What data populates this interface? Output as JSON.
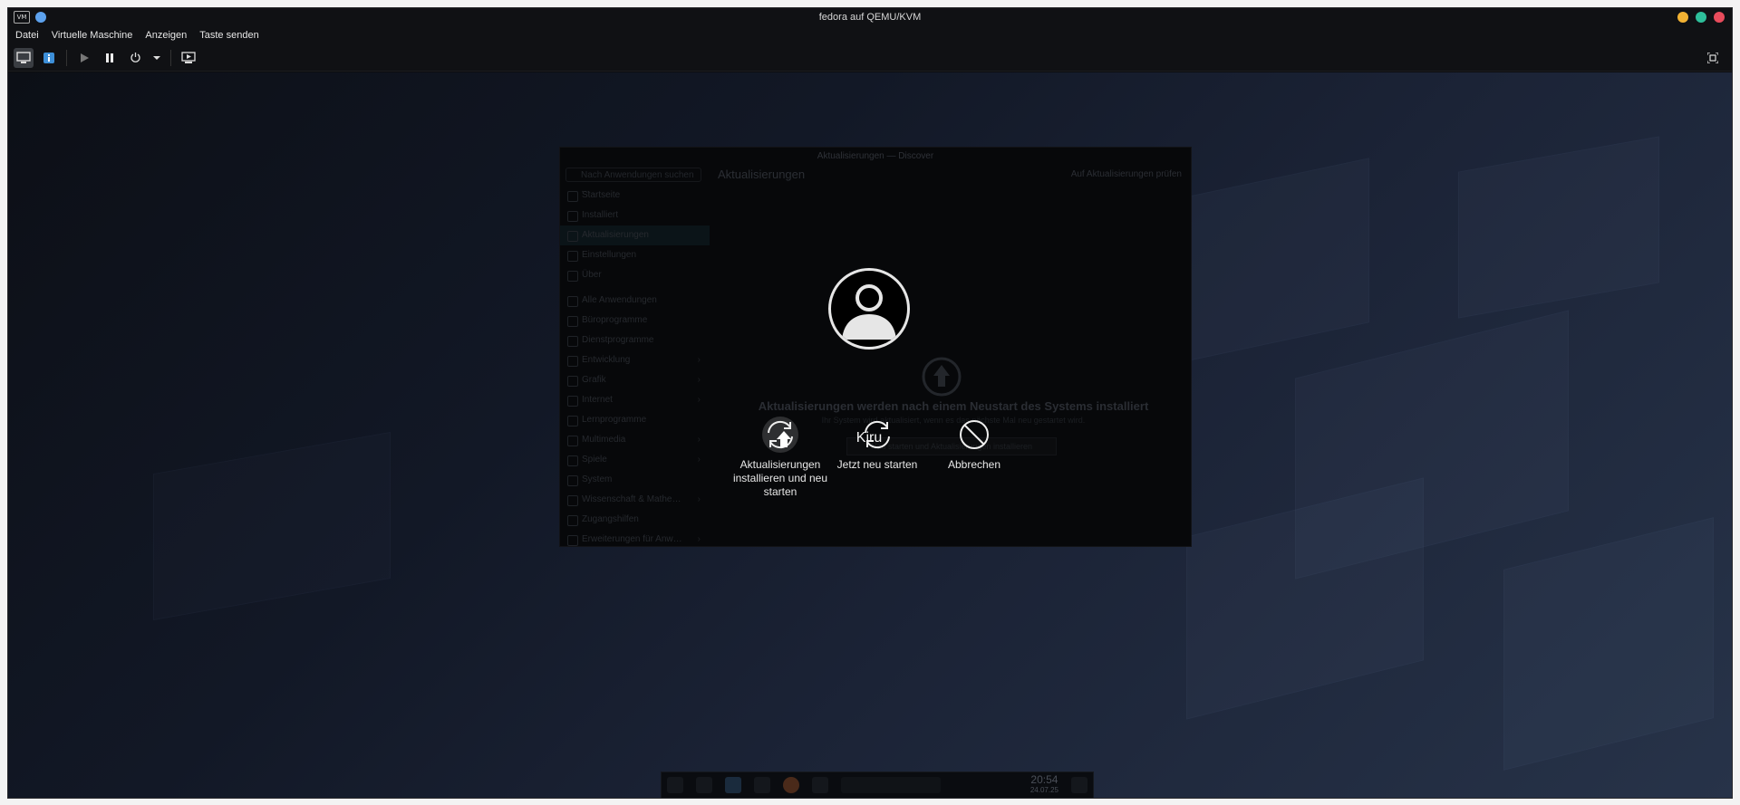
{
  "window": {
    "title": "fedora auf QEMU/KVM",
    "app_icon_text": "VM",
    "traffic_colors": [
      "#f2b233",
      "#2ebf9a",
      "#e84c5c"
    ]
  },
  "menu": {
    "items": [
      "Datei",
      "Virtuelle Maschine",
      "Anzeigen",
      "Taste senden"
    ]
  },
  "toolbar": {
    "buttons": [
      {
        "name": "console-icon",
        "active": true
      },
      {
        "name": "details-icon"
      },
      {
        "name": "run-icon"
      },
      {
        "name": "pause-icon"
      },
      {
        "name": "power-icon"
      },
      {
        "name": "power-dropdown-icon"
      },
      {
        "name": "screenshot-icon"
      }
    ],
    "fullscreen_icon": "fit-window-icon"
  },
  "discover": {
    "window_title": "Aktualisierungen — Discover",
    "search_placeholder": "Nach Anwendungen suchen …",
    "header": "Aktualisierungen",
    "check_label": "Auf Aktualisierungen prüfen",
    "sidebar": [
      {
        "label": "Startseite"
      },
      {
        "label": "Installiert"
      },
      {
        "label": "Aktualisierungen",
        "selected": true
      },
      {
        "label": "Einstellungen"
      },
      {
        "label": "Über"
      },
      {
        "label": "Alle Anwendungen",
        "gap": true
      },
      {
        "label": "Büroprogramme"
      },
      {
        "label": "Dienstprogramme"
      },
      {
        "label": "Entwicklung",
        "chevron": true
      },
      {
        "label": "Grafik",
        "chevron": true
      },
      {
        "label": "Internet",
        "chevron": true
      },
      {
        "label": "Lernprogramme"
      },
      {
        "label": "Multimedia",
        "chevron": true
      },
      {
        "label": "Spiele",
        "chevron": true
      },
      {
        "label": "System"
      },
      {
        "label": "Wissenschaft & Mathe…",
        "chevron": true
      },
      {
        "label": "Zugangshilfen"
      },
      {
        "label": "Erweiterungen für Anw…",
        "chevron": true
      }
    ],
    "message": "Aktualisierungen werden nach einem Neustart des Systems installiert",
    "sub_message": "Ihr System wird aktualisiert, wenn es das nächste Mal neu gestartet wird.",
    "restart_button": "Neu starten und Aktualisierungen installieren"
  },
  "logout": {
    "username": "Kiru",
    "actions": [
      {
        "id": "install-restart",
        "label": "Aktualisierungen installieren und neu starten",
        "focused": true
      },
      {
        "id": "restart",
        "label": "Jetzt neu starten"
      },
      {
        "id": "cancel",
        "label": "Abbrechen"
      }
    ]
  },
  "taskbar": {
    "time": "20:54",
    "date": "24.07.25"
  }
}
